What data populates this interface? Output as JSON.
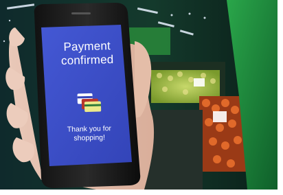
{
  "phone_screen": {
    "title_line1": "Payment",
    "title_line2": "confirmed",
    "message_line1": "Thank you for",
    "message_line2": "shopping!",
    "icon": "payment-cards-icon"
  },
  "colors": {
    "screen_background": "#3d4fc7",
    "background_store": "#0b1a1c",
    "green_panel": "#1d8f3a"
  }
}
